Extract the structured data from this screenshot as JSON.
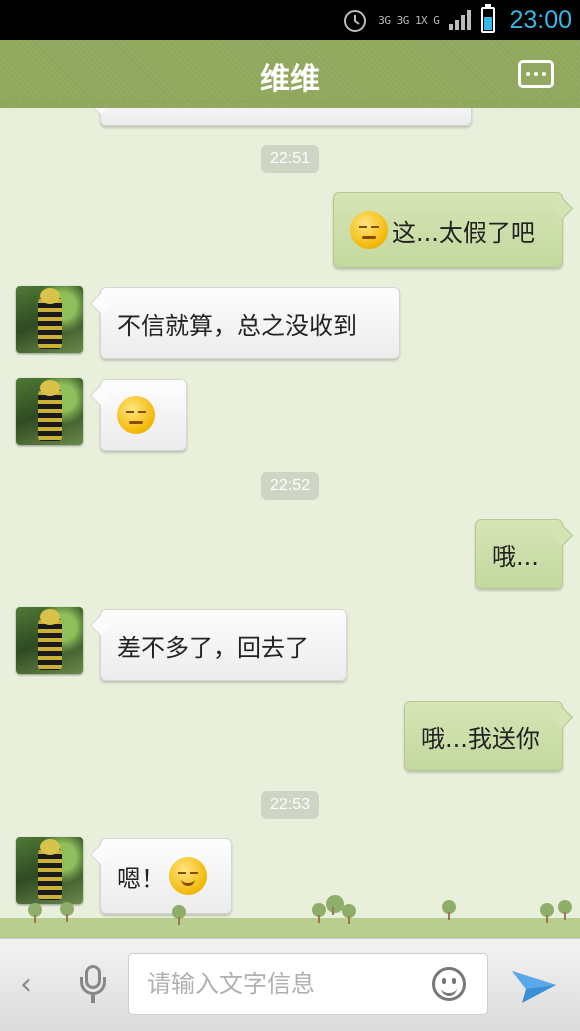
{
  "status_bar": {
    "network": "3G 3G 1X G",
    "time": "23:00",
    "battery_level": 0.6
  },
  "header": {
    "title": "维维",
    "more_icon": "more-icon"
  },
  "chat": {
    "timestamps": [
      "22:51",
      "22:52",
      "22:53"
    ],
    "messages": [
      {
        "side": "out",
        "emoji": "sweat-face",
        "text": "这...太假了吧"
      },
      {
        "side": "in",
        "text": "不信就算，总之没收到"
      },
      {
        "side": "in",
        "emoji": "smirk-face",
        "text": ""
      },
      {
        "side": "out",
        "text": "哦..."
      },
      {
        "side": "in",
        "text": "差不多了，回去了"
      },
      {
        "side": "out",
        "text": "哦...我送你"
      },
      {
        "side": "in",
        "text": "嗯！",
        "emoji": "smile-face"
      }
    ]
  },
  "input_bar": {
    "placeholder": "请输入文字信息",
    "back_icon": "chevron-left-icon",
    "mic_icon": "microphone-icon",
    "emoji_icon": "smiley-icon",
    "send_icon": "paper-plane-icon"
  },
  "colors": {
    "header": "#8fa75b",
    "background": "#e8f0dc",
    "outgoing_bubble": "#cfe0ad",
    "time_accent": "#35b7e8"
  }
}
